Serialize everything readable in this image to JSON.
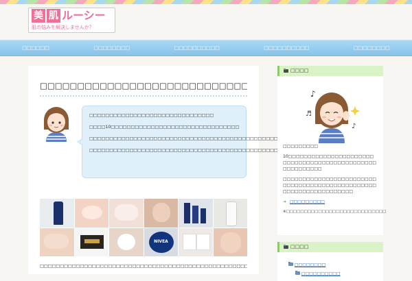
{
  "header": {
    "logo_chars": [
      "美",
      "肌"
    ],
    "logo_rest": "ルーシー",
    "tagline": "肌の悩みを解決しませんか？"
  },
  "nav": {
    "items": [
      "□□□□□□",
      "□□□□□□□□",
      "□□□□□□□□□□",
      "□□□□□□□□□□",
      "□□□□□□□□"
    ]
  },
  "article": {
    "title": "□□□□□□□□□□□□□□□□□□□□□□□□□□□□",
    "bubble": [
      "□□□□□□□□□□□□□□□□□□□□□□□□□□□□□□□",
      "□□□□10□□□□□□□□□□□□□□□□□□□□□□□□□□□□□□□□",
      "□□□□□□□□□□□□□□□□□□□□□□□□□□□□□□□□□□□□□□□□□□□□□□□□□□□□□□□□□",
      "□□□□□□□□□□□□□□□□□□□□□□□□□□□□□□□□□□□□□□□□□□□□□□□□□□□□□□□□□"
    ],
    "photo_labels": {
      "nivea": "NIVEA"
    },
    "body": "□□□□□□□□□□□□□□□□□□□□□□□□□□□□□□□□□□□□□□□□□□□□□□□□□□□□□□□□□□□□"
  },
  "sidebar": {
    "profile": {
      "title": "□□□□",
      "name": "□□□□□□□□□",
      "text1": "10□□□□□□□□□□□□□□□□□□□□□□□□□□□□□□□□□□□□□□□□□□□□□□□□□□□□□□□□",
      "text2": "□□□□□□□□□□□□□□□□□□□□□□□□□□□□□□□□□□□□□□□□□□□□□□□□□□□□□□□□□□□□□□□□□□",
      "link": "□□□□□□□□□",
      "note": "※□□□□□□□□□□□□□□□□□□□□□□□□□□□□"
    },
    "category": {
      "title": "□□□□",
      "items": [
        "□□□□□□□□",
        "□□□□□□□□□□"
      ]
    }
  },
  "colors": {
    "accent_pink": "#ef6f96",
    "nav_blue": "#87c3ea",
    "bubble_blue": "#dff0fb",
    "widget_green": "#d9f3c6"
  }
}
